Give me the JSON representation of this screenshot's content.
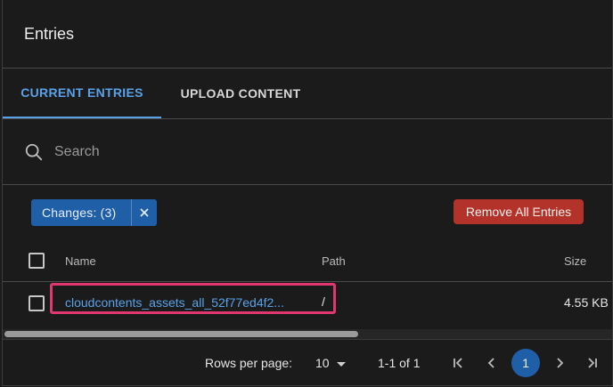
{
  "header": {
    "title": "Entries"
  },
  "tabs": [
    {
      "label": "CURRENT ENTRIES"
    },
    {
      "label": "UPLOAD CONTENT"
    }
  ],
  "search": {
    "placeholder": "Search"
  },
  "filters": {
    "changes_chip": "Changes: (3)",
    "remove_all_label": "Remove All Entries"
  },
  "table": {
    "columns": {
      "name": "Name",
      "path": "Path",
      "size": "Size"
    },
    "rows": [
      {
        "name": "cloudcontents_assets_all_52f77ed4f2...",
        "path": "/",
        "size": "4.55 KB"
      }
    ]
  },
  "pagination": {
    "rows_per_page_label": "Rows per page:",
    "rows_per_page_value": "10",
    "range": "1-1 of 1",
    "current_page": "1"
  },
  "colors": {
    "accent": "#5aa2e8",
    "chip": "#1f5fa8",
    "danger": "#b3322a",
    "highlight": "#e0386e"
  }
}
